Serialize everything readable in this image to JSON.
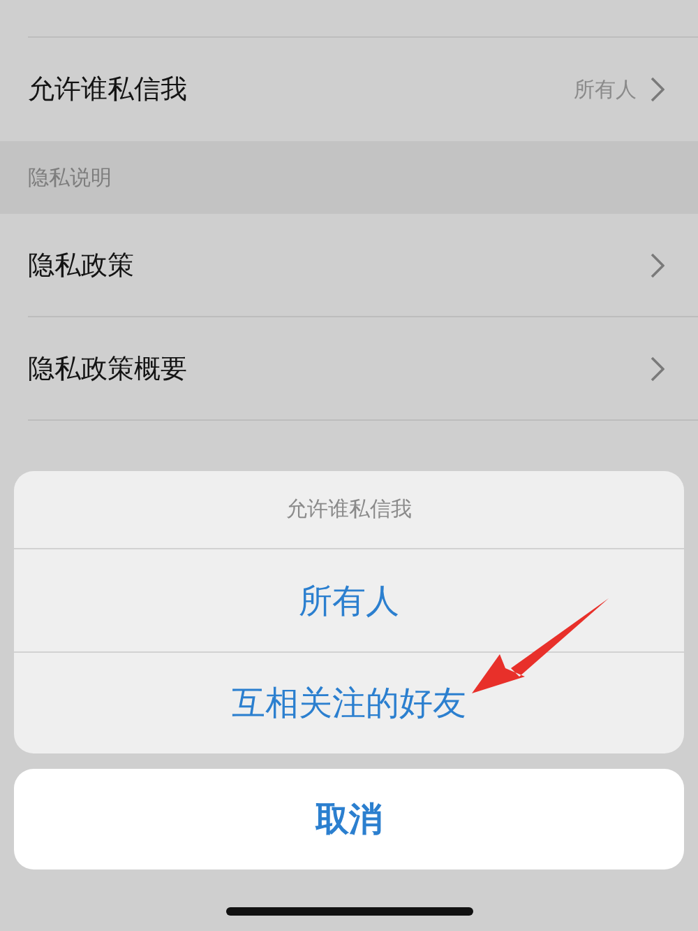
{
  "settings": [
    {
      "kind": "row",
      "label": "允许谁私信我",
      "value": "所有人"
    },
    {
      "kind": "header",
      "label": "隐私说明"
    },
    {
      "kind": "row",
      "label": "隐私政策"
    },
    {
      "kind": "row",
      "label": "隐私政策概要"
    }
  ],
  "action_sheet": {
    "title": "允许谁私信我",
    "options": [
      "所有人",
      "互相关注的好友"
    ],
    "cancel": "取消"
  }
}
